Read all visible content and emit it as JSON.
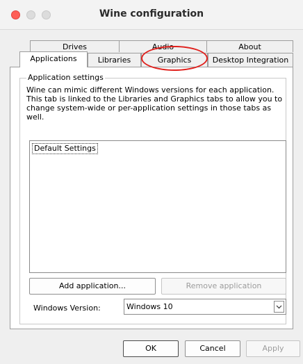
{
  "window": {
    "title": "Wine configuration"
  },
  "tabs_row1": [
    {
      "label": "Drives"
    },
    {
      "label": "Audio"
    },
    {
      "label": "About"
    }
  ],
  "tabs_row2": [
    {
      "label": "Applications"
    },
    {
      "label": "Libraries"
    },
    {
      "label": "Graphics"
    },
    {
      "label": "Desktop Integration"
    }
  ],
  "app_settings": {
    "legend": "Application settings",
    "description": "Wine can mimic different Windows versions for each application. This tab is linked to the Libraries and Graphics tabs to allow you to change system-wide or per-application settings in those tabs as well.",
    "list_items": [
      "Default Settings"
    ],
    "add_button": "Add application...",
    "remove_button": "Remove application",
    "version_label": "Windows Version:",
    "version_value": "Windows 10"
  },
  "dialog_buttons": {
    "ok": "OK",
    "cancel": "Cancel",
    "apply": "Apply"
  },
  "colors": {
    "close": "#fe5f57",
    "highlight": "#e0201c"
  }
}
